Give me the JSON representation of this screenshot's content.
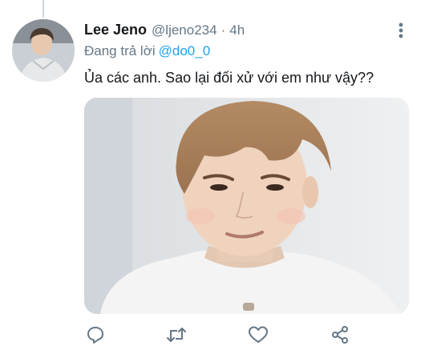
{
  "tweet": {
    "author_name": "Lee Jeno",
    "author_handle": "@ljeno234",
    "separator": "·",
    "time": "4h",
    "reply_prefix": "Đang trả lời",
    "reply_handle": "@do0_0",
    "text": "Ủa các anh. Sao lại đối xử với em như vậy??"
  },
  "icons": {
    "more": "more-vertical-icon",
    "reply": "reply-icon",
    "retweet": "retweet-icon",
    "like": "heart-icon",
    "share": "share-icon"
  },
  "colors": {
    "link": "#1da1f2",
    "secondary_text": "#657786",
    "icon": "#657786"
  }
}
